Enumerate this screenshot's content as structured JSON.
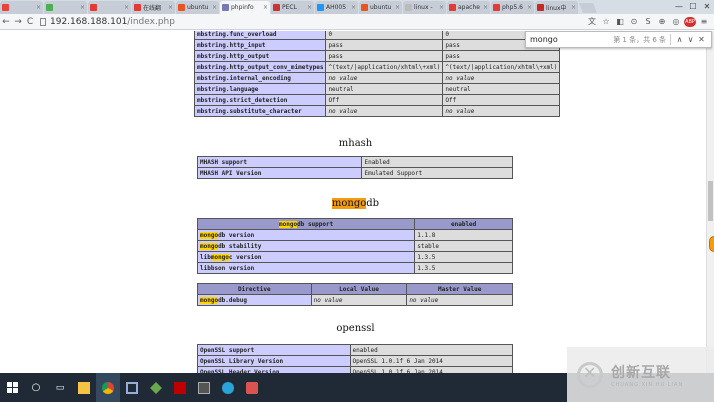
{
  "window": {
    "tabs": [
      {
        "label": "",
        "color": "#e9443a"
      },
      {
        "label": "",
        "color": "#4caf50"
      },
      {
        "label": "",
        "color": "#e53935"
      },
      {
        "label": "在线翻",
        "color": "#e53935"
      },
      {
        "label": "ubuntu",
        "color": "#e95420"
      },
      {
        "label": "phpinfo",
        "color": "#777bb3",
        "active": true
      },
      {
        "label": "PECL",
        "color": "#cc3333"
      },
      {
        "label": "AH005",
        "color": "#2196f3"
      },
      {
        "label": "ubuntu",
        "color": "#e95420"
      },
      {
        "label": "linux -",
        "color": "#bbbbbb"
      },
      {
        "label": "apache",
        "color": "#e53935"
      },
      {
        "label": "php5.6",
        "color": "#e53935"
      },
      {
        "label": "linux中",
        "color": "#c62828"
      }
    ],
    "controls": {
      "minimize": "—",
      "maximize": "☐",
      "close": "✕"
    }
  },
  "toolbar": {
    "back": "←",
    "forward": "→",
    "reload": "C",
    "url_host": "192.168.188.101",
    "url_path": "/index.php"
  },
  "findbar": {
    "query": "mongo",
    "count": "第 1 条，共 6 条"
  },
  "top_table": {
    "rows": [
      [
        "mbstring.func_overload",
        "0",
        "0"
      ],
      [
        "mbstring.http_input",
        "pass",
        "pass"
      ],
      [
        "mbstring.http_output",
        "pass",
        "pass"
      ],
      [
        "mbstring.http_output_conv_mimetypes",
        "^(text/|application/xhtml\\+xml)",
        "^(text/|application/xhtml\\+xml)"
      ],
      [
        "mbstring.internal_encoding",
        "no value",
        "no value"
      ],
      [
        "mbstring.language",
        "neutral",
        "neutral"
      ],
      [
        "mbstring.strict_detection",
        "Off",
        "Off"
      ],
      [
        "mbstring.substitute_character",
        "no value",
        "no value"
      ]
    ]
  },
  "mhash": {
    "title": "mhash",
    "rows": [
      [
        "MHASH support",
        "Enabled"
      ],
      [
        "MHASH API Version",
        "Emulated Support"
      ]
    ]
  },
  "mongodb": {
    "title_hl": "mongo",
    "title_rest": "db",
    "header_hl": "mongo",
    "header_rest": "db support",
    "header_value": "enabled",
    "rows": [
      {
        "hl": "mongo",
        "rest": "db version",
        "value": "1.1.8"
      },
      {
        "hl": "mongo",
        "rest": "db stability",
        "value": "stable"
      },
      {
        "pre": "lib",
        "hl": "mongo",
        "rest": "c version",
        "value": "1.3.5"
      },
      {
        "pre": "libbson version",
        "hl": "",
        "rest": "",
        "value": "1.3.5"
      }
    ],
    "directive_headers": [
      "Directive",
      "Local Value",
      "Master Value"
    ],
    "directive_row": {
      "hl": "mongo",
      "rest": "db.debug",
      "local": "no value",
      "master": "no value"
    }
  },
  "openssl": {
    "title": "openssl",
    "rows": [
      [
        "OpenSSL support",
        "enabled"
      ],
      [
        "OpenSSL Library Version",
        "OpenSSL 1.0.1f 6 Jan 2014"
      ],
      [
        "OpenSSL Header Version",
        "OpenSSL 1.0.1f 6 Jan 2014"
      ]
    ]
  },
  "watermark": {
    "cn": "创新互联",
    "en": "CHUANG XIN HU LIAN"
  }
}
